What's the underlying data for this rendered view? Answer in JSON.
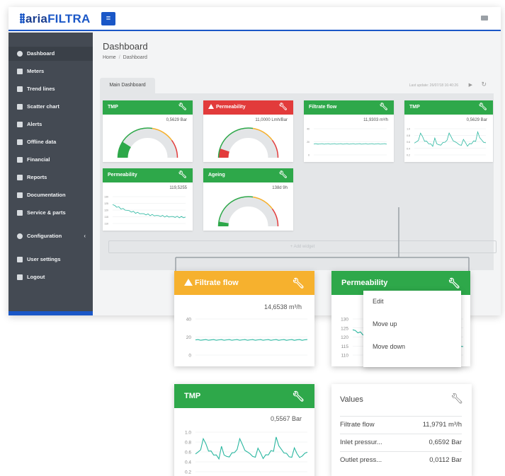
{
  "app": {
    "logo_prefix": "aria",
    "logo_suffix": "FILTRA",
    "menu_icon": "hamburger-icon",
    "page_title": "Dashboard",
    "breadcrumb": [
      "Home",
      "Dashboard"
    ],
    "tab_main": "Main Dashboard",
    "last_update": "Last update: 26/07/18 16:40:26",
    "add_widget": "+ Add widget",
    "colors": {
      "accent": "#1a57c7",
      "sidebar": "#444a53",
      "green": "#2ea84a",
      "red": "#e23b3b",
      "orange": "#f6b12e"
    }
  },
  "sidebar": {
    "items": [
      {
        "label": "Dashboard",
        "icon": "palette-icon"
      },
      {
        "label": "Meters",
        "icon": "list-icon"
      },
      {
        "label": "Trend lines",
        "icon": "line-chart-icon"
      },
      {
        "label": "Scatter chart",
        "icon": "bar-chart-icon"
      },
      {
        "label": "Alerts",
        "icon": "warning-icon"
      },
      {
        "label": "Offline data",
        "icon": "pencil-icon"
      },
      {
        "label": "Financial",
        "icon": "money-icon"
      },
      {
        "label": "Reports",
        "icon": "document-icon"
      },
      {
        "label": "Documentation",
        "icon": "bookmark-icon"
      },
      {
        "label": "Service & parts",
        "icon": "calendar-icon"
      },
      {
        "label": "Configuration",
        "icon": "gear-icon"
      },
      {
        "label": "User settings",
        "icon": "user-icon"
      },
      {
        "label": "Logout",
        "icon": "logout-icon"
      }
    ],
    "config_chevron": "‹"
  },
  "widgets": {
    "tmp_gauge": {
      "title": "TMP",
      "value": "0,5629 Bar",
      "level": 0.18
    },
    "perm_gauge": {
      "title": "Permeability",
      "value": "11,0000 Lmh/Bar",
      "level": 0.1
    },
    "filtrate": {
      "title": "Filtrate flow",
      "value": "11,9303 m³/h",
      "ticks": [
        "40",
        "20",
        "0"
      ]
    },
    "tmp_line": {
      "title": "TMP",
      "value": "0,5629 Bar",
      "ticks": [
        "1.0",
        "0.8",
        "0.6",
        "0.4",
        "0.2"
      ]
    },
    "perm_line": {
      "title": "Permeability",
      "value": "119,5255",
      "ticks": [
        "130",
        "125",
        "120",
        "115",
        "110"
      ]
    },
    "ageing": {
      "title": "Ageing",
      "value": "138d 9h",
      "level": 0.05
    }
  },
  "zoom": {
    "filtrate": {
      "title": "Filtrate flow",
      "value": "14,6538 m³/h",
      "ticks": [
        "40",
        "20",
        "0"
      ]
    },
    "permeability": {
      "title": "Permeability",
      "ticks": [
        "130",
        "125",
        "120",
        "115",
        "110"
      ]
    },
    "context_menu": [
      "Edit",
      "Move up",
      "Move down"
    ],
    "tmp": {
      "title": "TMP",
      "value": "0,5567 Bar",
      "ticks": [
        "1.0",
        "0.8",
        "0.6",
        "0.4",
        "0.2"
      ]
    },
    "values": {
      "title": "Values",
      "rows": [
        {
          "label": "Filtrate flow",
          "value": "11,9791 m³/h"
        },
        {
          "label": "Inlet pressur...",
          "value": "0,6592 Bar"
        },
        {
          "label": "Outlet press...",
          "value": "0,0112 Bar"
        }
      ]
    }
  }
}
